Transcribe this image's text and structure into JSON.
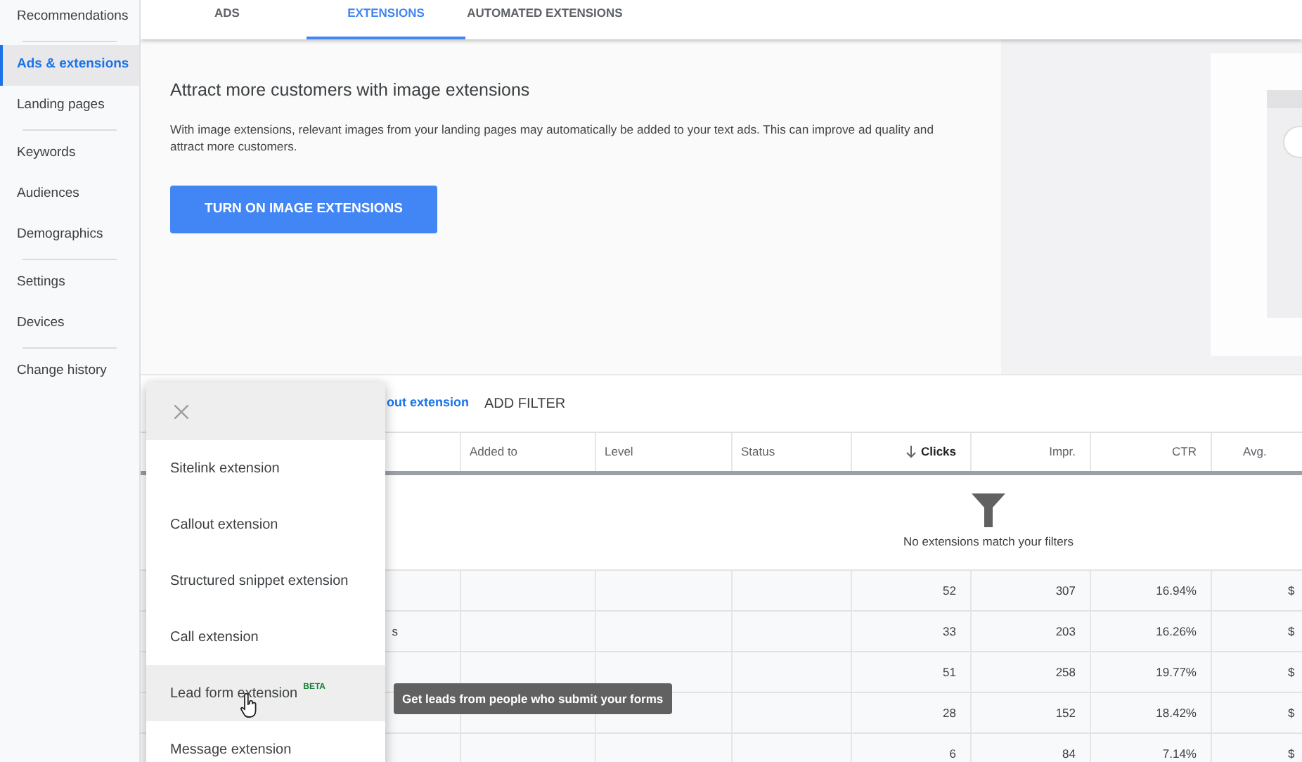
{
  "sidebar": {
    "groups": [
      [
        {
          "label": "Recommendations",
          "selected": false
        }
      ],
      [
        {
          "label": "Ads & extensions",
          "selected": true
        },
        {
          "label": "Landing pages",
          "selected": false
        }
      ],
      [
        {
          "label": "Keywords",
          "selected": false
        },
        {
          "label": "Audiences",
          "selected": false
        },
        {
          "label": "Demographics",
          "selected": false
        }
      ],
      [
        {
          "label": "Settings",
          "selected": false
        },
        {
          "label": "Devices",
          "selected": false
        }
      ],
      [
        {
          "label": "Change history",
          "selected": false
        }
      ]
    ]
  },
  "tabs": [
    {
      "label": "ADS",
      "selected": false
    },
    {
      "label": "EXTENSIONS",
      "selected": true
    },
    {
      "label": "AUTOMATED EXTENSIONS",
      "selected": false
    }
  ],
  "banner": {
    "title": "Attract more customers with image extensions",
    "text": "With image extensions, relevant images from your landing pages may automatically be added to your text ads. This can improve ad quality and attract more customers.",
    "button": "TURN ON IMAGE EXTENSIONS"
  },
  "filter_bar": {
    "chip": "out extension",
    "add_filter": "ADD FILTER"
  },
  "table": {
    "columns": [
      {
        "label": "Added to",
        "sorted": false
      },
      {
        "label": "Level",
        "sorted": false
      },
      {
        "label": "Status",
        "sorted": false
      },
      {
        "label": "Clicks",
        "sorted": true
      },
      {
        "label": "Impr.",
        "sorted": false
      },
      {
        "label": "CTR",
        "sorted": false
      },
      {
        "label": "Avg.",
        "sorted": false
      }
    ],
    "empty_message": "No extensions match your filters",
    "rows": [
      {
        "clicks": "52",
        "impr": "307",
        "ctr": "16.94%",
        "column_8": "$"
      },
      {
        "column_1": "s",
        "clicks": "33",
        "impr": "203",
        "ctr": "16.26%",
        "column_8": "$"
      },
      {
        "clicks": "51",
        "impr": "258",
        "ctr": "19.77%",
        "column_8": "$"
      },
      {
        "clicks": "28",
        "impr": "152",
        "ctr": "18.42%",
        "column_8": "$"
      },
      {
        "clicks": "6",
        "impr": "84",
        "ctr": "7.14%",
        "column_8": "$"
      }
    ]
  },
  "menu": {
    "items": [
      {
        "label": "Sitelink extension",
        "hovered": false
      },
      {
        "label": "Callout extension",
        "hovered": false
      },
      {
        "label": "Structured snippet extension",
        "hovered": false
      },
      {
        "label": "Call extension",
        "hovered": false
      },
      {
        "label": "Lead form extension",
        "badge": "BETA",
        "hovered": true
      },
      {
        "label": "Message extension",
        "hovered": false
      }
    ]
  },
  "tooltip": "Get leads from people who submit your forms"
}
